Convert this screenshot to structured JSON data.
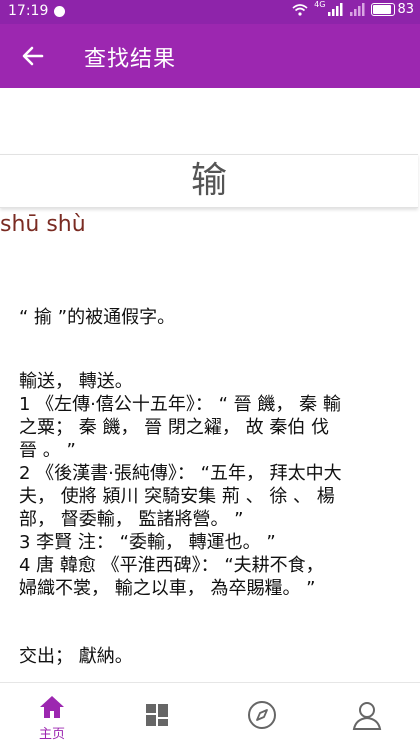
{
  "status_bar": {
    "time": "17:19",
    "network": "4G",
    "battery": "83"
  },
  "header": {
    "title": "查找结果"
  },
  "word": {
    "character": "输",
    "pinyin": "shū shù"
  },
  "definitions": [
    "“ 揄 ”的被通假字。",
    "輸送， 轉送。",
    "1 《左傳·僖公十五年》： “ 晉 饑， 秦 輸",
    "之粟； 秦 饑， 晉 閉之糴， 故 秦伯 伐",
    "晉 。 ”",
    "2 《後漢書·張純傳》： “五年， 拜太中大",
    "夫， 使將 潁川 突騎安集 荊 、 徐 、 楊",
    "部， 督委輸， 監諸將營。 ”",
    "3 李賢 注： “委輸， 轉運也。 ”",
    "4 唐 韓愈 《平淮西碑》： “夫耕不食，",
    "婦織不裳， 輸之以車， 為卒賜糧。 ”",
    "交出； 獻納。"
  ],
  "bottom_nav": {
    "home_label": "主页",
    "items": [
      "home-icon",
      "grid-icon",
      "compass-icon",
      "person-icon"
    ],
    "active_color": "#9c27b0",
    "inactive_color": "#666666"
  },
  "colors": {
    "appbar": "#9c27b0",
    "statusbar": "#8e24aa",
    "pinyin": "#7a2b22"
  }
}
